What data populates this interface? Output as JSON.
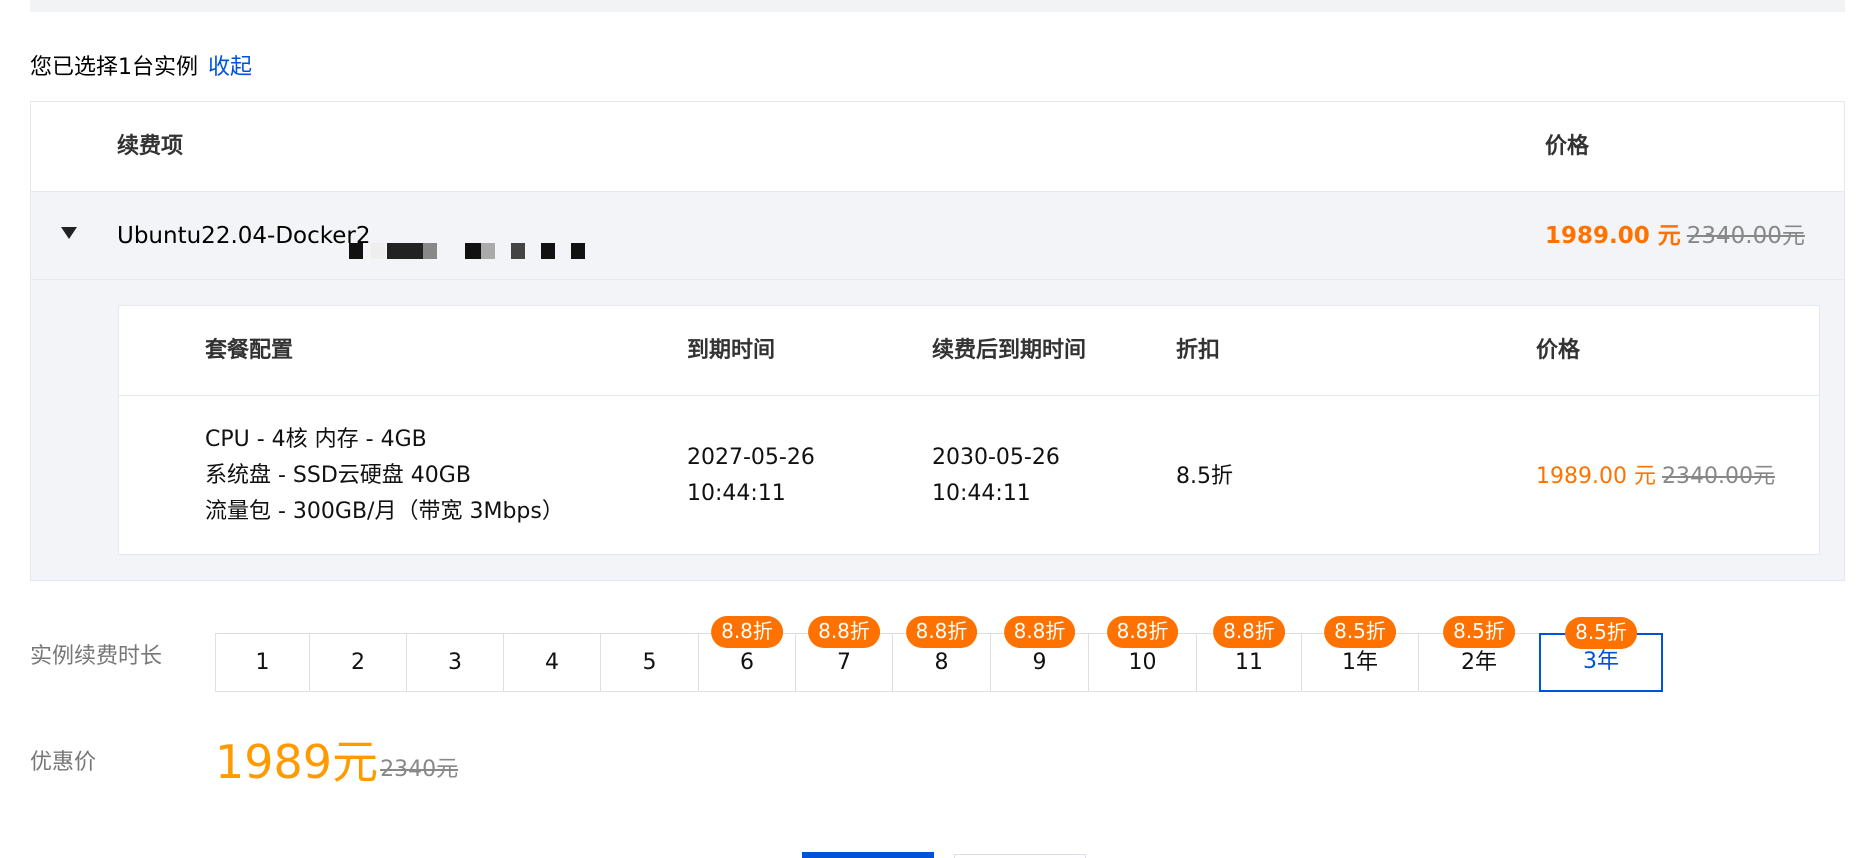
{
  "selection": {
    "summary": "您已选择1台实例",
    "collapse_label": "收起"
  },
  "outer_table": {
    "headers": {
      "item": "续费项",
      "price": "价格"
    },
    "instance": {
      "name": "Ubuntu22.04-Docker2",
      "price_now": "1989.00 元",
      "price_old": "2340.00元"
    }
  },
  "inner_table": {
    "headers": {
      "config": "套餐配置",
      "expire": "到期时间",
      "renew_expire": "续费后到期时间",
      "discount": "折扣",
      "price": "价格"
    },
    "row": {
      "config_lines": [
        "CPU - 4核 内存 - 4GB",
        "系统盘 - SSD云硬盘 40GB",
        "流量包 - 300GB/月（带宽 3Mbps）"
      ],
      "expire_date": "2027-05-26",
      "expire_time": "10:44:11",
      "renew_date": "2030-05-26",
      "renew_time": "10:44:11",
      "discount": "8.5折",
      "price_now": "1989.00 元",
      "price_old": "2340.00元"
    }
  },
  "duration": {
    "label": "实例续费时长",
    "options": [
      {
        "label": "1",
        "badge": ""
      },
      {
        "label": "2",
        "badge": ""
      },
      {
        "label": "3",
        "badge": ""
      },
      {
        "label": "4",
        "badge": ""
      },
      {
        "label": "5",
        "badge": ""
      },
      {
        "label": "6",
        "badge": "8.8折"
      },
      {
        "label": "7",
        "badge": "8.8折"
      },
      {
        "label": "8",
        "badge": "8.8折"
      },
      {
        "label": "9",
        "badge": "8.8折"
      },
      {
        "label": "10",
        "badge": "8.8折"
      },
      {
        "label": "11",
        "badge": "8.8折"
      },
      {
        "label": "1年",
        "badge": "8.5折"
      },
      {
        "label": "2年",
        "badge": "8.5折"
      },
      {
        "label": "3年",
        "badge": "8.5折",
        "selected": true
      }
    ]
  },
  "promo": {
    "label": "优惠价",
    "price_now": "1989元",
    "price_old": "2340元"
  },
  "colors": {
    "accent": "#0052d9",
    "price": "#ff7200",
    "promo_price": "#ff9a00",
    "badge": "#ff7200"
  }
}
